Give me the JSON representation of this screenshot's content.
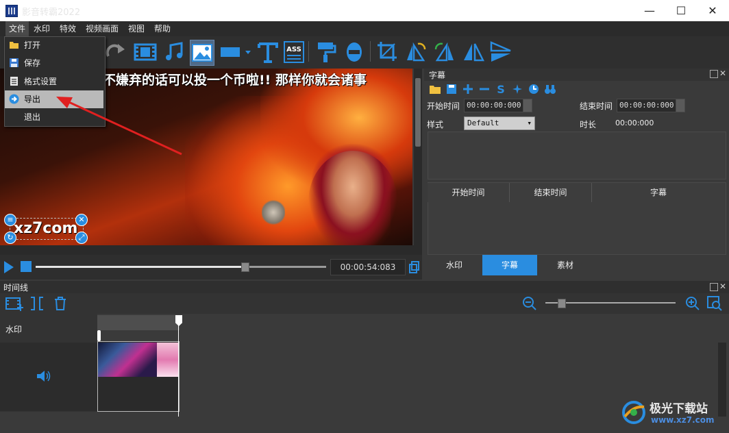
{
  "window": {
    "title": "影音转霸2022",
    "controls": {
      "minimize": "—",
      "maximize": "☐",
      "close": "✕"
    }
  },
  "menubar": [
    "文件",
    "水印",
    "特效",
    "视频画面",
    "视图",
    "帮助"
  ],
  "file_menu": {
    "items": [
      {
        "label": "打开",
        "icon": "folder-icon"
      },
      {
        "label": "保存",
        "icon": "save-icon"
      },
      {
        "label": "格式设置",
        "icon": "settings-doc-icon"
      },
      {
        "label": "导出",
        "icon": "export-icon",
        "highlighted": true
      },
      {
        "label": "退出",
        "icon": ""
      }
    ]
  },
  "preview": {
    "caption": "不嫌弃的话可以投一个币啦!! 那样你就会诸事",
    "watermark_text": "xz7com",
    "time": "00:00:54:083",
    "progress": 0.72
  },
  "subtitle_panel": {
    "title": "字幕",
    "start_label": "开始时间",
    "start_value": "00:00:00:000",
    "end_label": "结束时间",
    "end_value": "00:00:00:000",
    "style_label": "样式",
    "style_value": "Default",
    "duration_label": "时长",
    "duration_value": "00:00:000",
    "columns": [
      "开始时间",
      "结束时间",
      "字幕"
    ]
  },
  "tabs": [
    "水印",
    "字幕",
    "素材"
  ],
  "active_tab": "字幕",
  "timeline": {
    "title": "时间线",
    "watermark_track": "水印"
  },
  "site_logo": {
    "main": "极光下载站",
    "sub": "www.xz7.com"
  },
  "colors": {
    "accent": "#2a8de0",
    "arrow": "#e02020"
  }
}
